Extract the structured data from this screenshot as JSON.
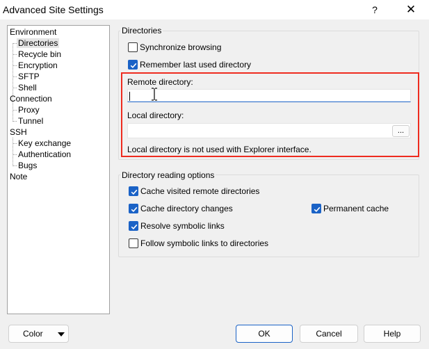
{
  "window": {
    "title": "Advanced Site Settings",
    "help": "?",
    "close": "✕"
  },
  "tree": {
    "environment": "Environment",
    "directories": "Directories",
    "recycle_bin": "Recycle bin",
    "encryption": "Encryption",
    "sftp": "SFTP",
    "shell": "Shell",
    "connection": "Connection",
    "proxy": "Proxy",
    "tunnel": "Tunnel",
    "ssh": "SSH",
    "key_exchange": "Key exchange",
    "authentication": "Authentication",
    "bugs": "Bugs",
    "note": "Note",
    "selected": "Directories"
  },
  "directories": {
    "group_title": "Directories",
    "sync_browsing": {
      "label": "Synchronize browsing",
      "checked": false
    },
    "remember_last": {
      "label": "Remember last used directory",
      "checked": true
    },
    "remote_dir_label": "Remote directory:",
    "remote_dir_value": "",
    "local_dir_label": "Local directory:",
    "local_dir_value": "",
    "browse_label": "...",
    "note": "Local directory is not used with Explorer interface."
  },
  "reading": {
    "group_title": "Directory reading options",
    "cache_visited": {
      "label": "Cache visited remote directories",
      "checked": true
    },
    "cache_changes": {
      "label": "Cache directory changes",
      "checked": true
    },
    "permanent_cache": {
      "label": "Permanent cache",
      "checked": true
    },
    "resolve_links": {
      "label": "Resolve symbolic links",
      "checked": true
    },
    "follow_links": {
      "label": "Follow symbolic links to directories",
      "checked": false
    }
  },
  "buttons": {
    "color": "Color",
    "ok": "OK",
    "cancel": "Cancel",
    "help": "Help"
  },
  "colors": {
    "accent": "#1a62c6",
    "highlight": "#ee2b1f",
    "window_bg": "#f0f0f0"
  }
}
